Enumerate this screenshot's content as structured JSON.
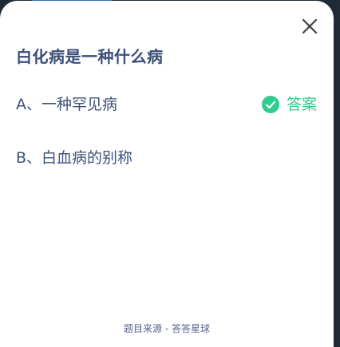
{
  "question": {
    "title": "白化病是一种什么病"
  },
  "options": [
    {
      "label": "A、一种罕见病",
      "is_answer": true
    },
    {
      "label": "B、白血病的别称",
      "is_answer": false
    }
  ],
  "answer_tag": {
    "label": "答案",
    "icon": "check-circle-icon",
    "color": "#2ecc8f"
  },
  "footer": {
    "source": "题目来源 - 答答星球"
  },
  "controls": {
    "close_icon": "close-icon"
  }
}
